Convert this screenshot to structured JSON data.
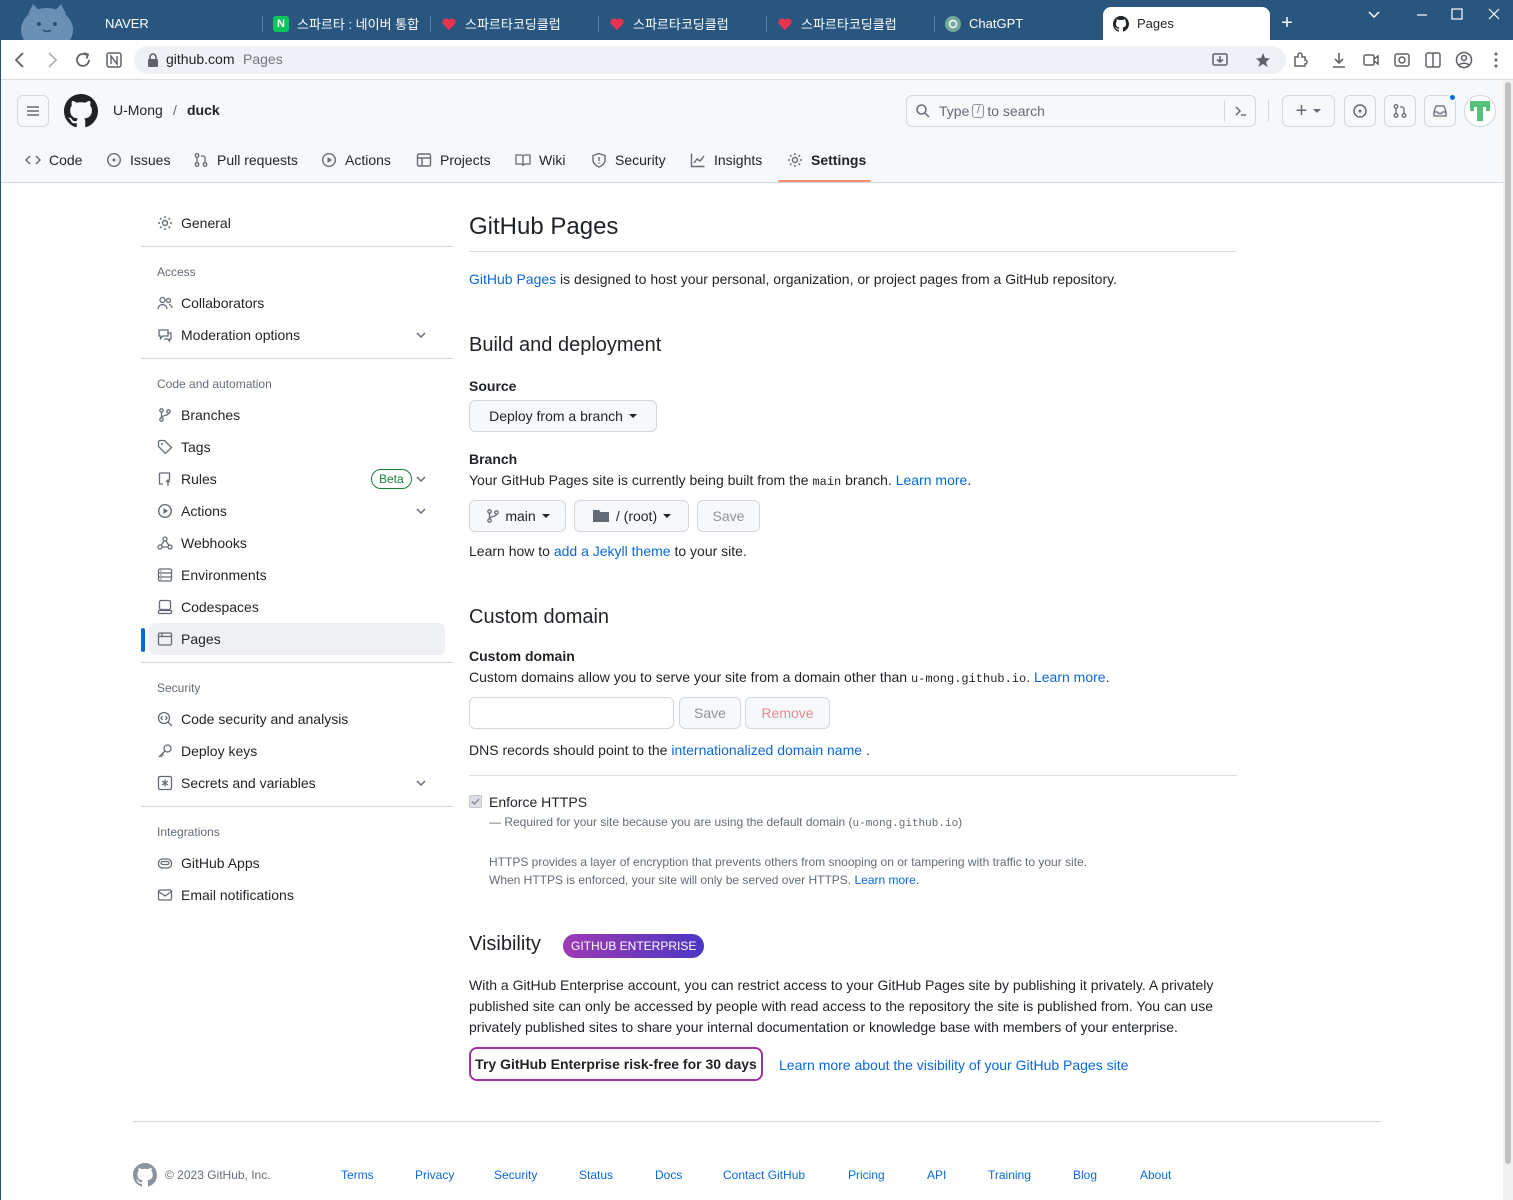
{
  "browser": {
    "tabs": [
      {
        "label": "NAVER",
        "icon": "none"
      },
      {
        "label": "스파르타 : 네이버 통합",
        "icon": "naver-icon"
      },
      {
        "label": "스파르타코딩클럽",
        "icon": "sparta-icon"
      },
      {
        "label": "스파르타코딩클럽",
        "icon": "sparta-icon"
      },
      {
        "label": "스파르타코딩클럽",
        "icon": "sparta-icon"
      },
      {
        "label": "ChatGPT",
        "icon": "chatgpt-icon"
      },
      {
        "label": "Pages",
        "icon": "github-icon"
      }
    ],
    "new_tab": "+",
    "url_host": "github.com",
    "url_path": "Pages",
    "naver_favicon_letter": "N",
    "tab_bar_color": "#29567f"
  },
  "header": {
    "owner": "U-Mong",
    "separator": "/",
    "repo": "duck",
    "search_prefix": "Type",
    "search_key": "/",
    "search_suffix": "to search",
    "create_label": "+"
  },
  "repo_nav": [
    {
      "label": "Code",
      "icon": "code-icon"
    },
    {
      "label": "Issues",
      "icon": "issue-icon"
    },
    {
      "label": "Pull requests",
      "icon": "pull-request-icon"
    },
    {
      "label": "Actions",
      "icon": "play-icon"
    },
    {
      "label": "Projects",
      "icon": "table-icon"
    },
    {
      "label": "Wiki",
      "icon": "book-icon"
    },
    {
      "label": "Security",
      "icon": "shield-icon"
    },
    {
      "label": "Insights",
      "icon": "graph-icon"
    },
    {
      "label": "Settings",
      "icon": "gear-icon",
      "selected": true
    }
  ],
  "sidebar": {
    "general": "General",
    "access_heading": "Access",
    "collaborators": "Collaborators",
    "moderation": "Moderation options",
    "code_heading": "Code and automation",
    "branches": "Branches",
    "tags": "Tags",
    "rules": "Rules",
    "beta": "Beta",
    "actions": "Actions",
    "webhooks": "Webhooks",
    "environments": "Environments",
    "codespaces": "Codespaces",
    "pages": "Pages",
    "security_heading": "Security",
    "code_security": "Code security and analysis",
    "deploy_keys": "Deploy keys",
    "secrets": "Secrets and variables",
    "integrations_heading": "Integrations",
    "github_apps": "GitHub Apps",
    "email_notifications": "Email notifications"
  },
  "main": {
    "title": "GitHub Pages",
    "intro_link": "GitHub Pages",
    "intro_text": " is designed to host your personal, organization, or project pages from a GitHub repository.",
    "build_heading": "Build and deployment",
    "source_label": "Source",
    "source_value": "Deploy from a branch",
    "branch_label": "Branch",
    "branch_text_1": "Your GitHub Pages site is currently being built from the ",
    "branch_code": "main",
    "branch_text_2": " branch. ",
    "learn_more": "Learn more",
    "branch_button": "main",
    "folder_button": "/ (root)",
    "save": "Save",
    "jekyll_text_1": "Learn how to ",
    "jekyll_link": "add a Jekyll theme",
    "jekyll_text_2": " to your site.",
    "custom_domain_heading": "Custom domain",
    "custom_domain_label": "Custom domain",
    "custom_domain_text_1": "Custom domains allow you to serve your site from a domain other than ",
    "custom_domain_code": "u-mong.github.io",
    "custom_domain_text_2": ". ",
    "custom_domain_value": "",
    "remove": "Remove",
    "dns_text": "DNS records should point to the ",
    "dns_link": "internationalized domain name",
    "dns_end": " .",
    "https_label": "Enforce HTTPS",
    "https_checked": true,
    "https_required_1": "— Required for your site because you are using the default domain (",
    "https_required_code": "u-mong.github.io",
    "https_required_2": ")",
    "https_desc_1": "HTTPS provides a layer of encryption that prevents others from snooping on or tampering with traffic to your site.",
    "https_desc_2": "When HTTPS is enforced, your site will only be served over HTTPS. ",
    "https_learn": "Learn more.",
    "visibility_heading": "Visibility",
    "enterprise_badge": "GITHUB ENTERPRISE",
    "visibility_p1": "With a GitHub Enterprise account, you can restrict access to your GitHub Pages site by publishing it privately. A privately",
    "visibility_p2": "published site can only be accessed by people with read access to the repository the site is published from. You can use",
    "visibility_p3": "privately published sites to share your internal documentation or knowledge base with members of your enterprise.",
    "try_button": "Try GitHub Enterprise risk-free for 30 days",
    "visibility_link": "Learn more about the visibility of your GitHub Pages site"
  },
  "footer": {
    "copyright": "© 2023 GitHub, Inc.",
    "links": [
      "Terms",
      "Privacy",
      "Security",
      "Status",
      "Docs",
      "Contact GitHub",
      "Pricing",
      "API",
      "Training",
      "Blog",
      "About"
    ]
  },
  "colors": {
    "accent": "#0969da",
    "settings_underline": "#fd8c73",
    "beta_green": "#1a7f37",
    "enterprise_purple": "#a035a5"
  }
}
